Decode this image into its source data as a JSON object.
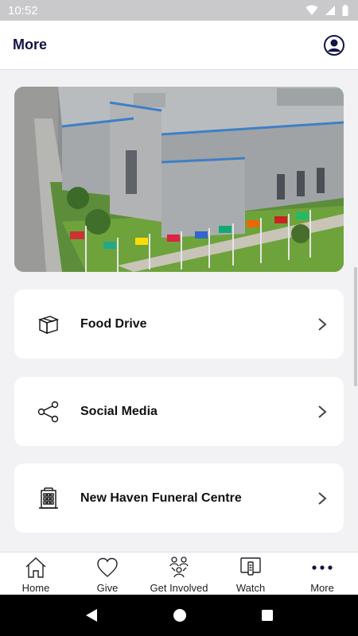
{
  "status_bar": {
    "time": "10:52"
  },
  "app_bar": {
    "title": "More"
  },
  "hero": {
    "alt": "Aerial view of church building with flags"
  },
  "menu": [
    {
      "label": "Food Drive",
      "icon": "box-icon"
    },
    {
      "label": "Social Media",
      "icon": "share-icon"
    },
    {
      "label": "New Haven Funeral Centre",
      "icon": "building-icon"
    }
  ],
  "tabs": [
    {
      "label": "Home",
      "icon": "home-icon"
    },
    {
      "label": "Give",
      "icon": "heart-icon"
    },
    {
      "label": "Get Involved",
      "icon": "people-icon"
    },
    {
      "label": "Watch",
      "icon": "tv-icon"
    },
    {
      "label": "More",
      "icon": "more-dots-icon"
    }
  ],
  "colors": {
    "accent": "#121347",
    "background": "#f2f2f4"
  }
}
